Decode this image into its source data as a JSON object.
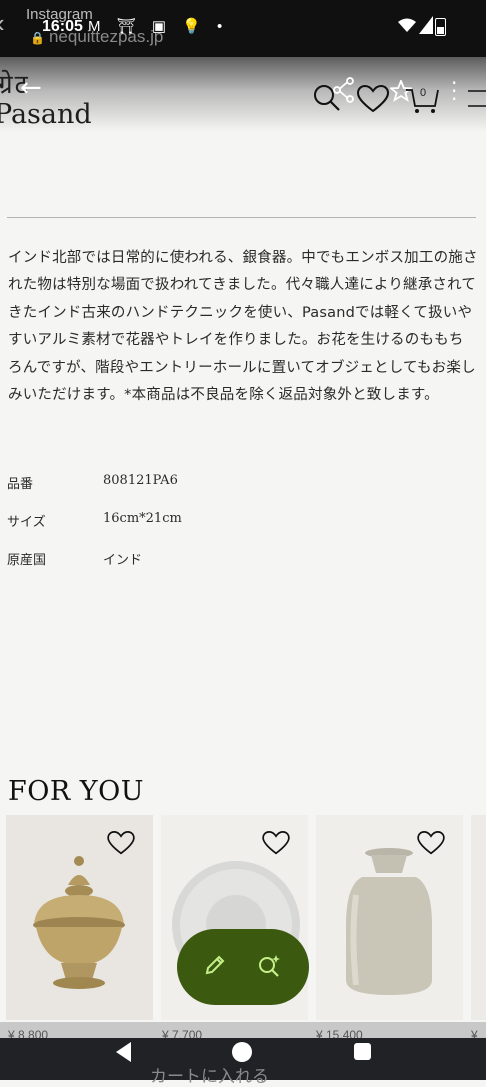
{
  "status_bar": {
    "app_name": "Instagram",
    "url": "nequittezpas.jp",
    "time": "16:05",
    "notification_icons": "M ⛩ ▣ 💡 •"
  },
  "header": {
    "logo_top": "ग्रेट",
    "logo_bottom": "Pasand",
    "cart_count": "0"
  },
  "description": "インド北部では日常的に使われる、銀食器。中でもエンボス加工の施された物は特別な場面で扱われてきました。代々職人達により継承されてきたインド古来のハンドテクニックを使い、Pasandでは軽くて扱いやすいアルミ素材で花器やトレイを作りました。お花を生けるのももちろんですが、階段やエントリーホールに置いてオブジェとしてもお楽しみいただけます。*本商品は不良品を除く返品対象外と致します。",
  "specs": [
    {
      "label": "品番",
      "value": "808121PA6"
    },
    {
      "label": "サイズ",
      "value": "16cm*21cm"
    },
    {
      "label": "原産国",
      "value": "インド"
    }
  ],
  "for_you": {
    "title": "FOR YOU",
    "prices": [
      "¥ 8,800",
      "¥ 7,700",
      "¥ 15,400",
      "¥"
    ]
  },
  "bottom": {
    "cart_label": "カートに入れる"
  },
  "colors": {
    "fab": "#3b5a10",
    "fab_icon": "#c6f08a"
  }
}
